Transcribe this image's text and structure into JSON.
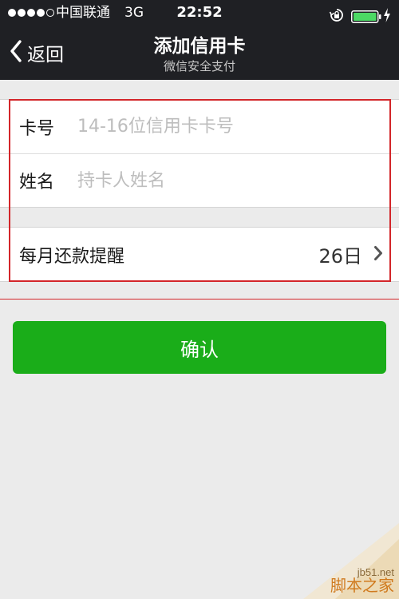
{
  "status_bar": {
    "carrier": "中国联通",
    "network": "3G",
    "time": "22:52",
    "signal_icon": "signal-dots-icon",
    "lock_icon": "rotation-lock-icon",
    "battery_icon": "battery-icon",
    "battery_color": "#4cd964",
    "charging_icon": "charging-bolt-icon"
  },
  "nav": {
    "back_label": "返回",
    "back_icon": "chevron-left-icon",
    "title": "添加信用卡",
    "subtitle": "微信安全支付"
  },
  "form": {
    "card_number": {
      "label": "卡号",
      "value": "",
      "placeholder": "14-16位信用卡卡号"
    },
    "name": {
      "label": "姓名",
      "value": "",
      "placeholder": "持卡人姓名"
    }
  },
  "reminder": {
    "label": "每月还款提醒",
    "value": "26日",
    "icon": "chevron-right-icon"
  },
  "confirm_button": {
    "label": "确认",
    "color": "#1aad19"
  },
  "annotation": {
    "color": "#d3262a"
  },
  "watermark": {
    "site": "jb51.net",
    "name": "脚本之家"
  }
}
